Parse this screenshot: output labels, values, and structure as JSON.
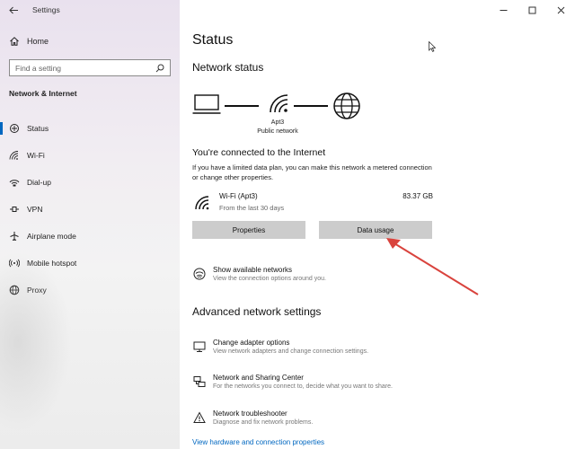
{
  "titlebar": {
    "app_title": "Settings"
  },
  "sidebar": {
    "home": "Home",
    "search_placeholder": "Find a setting",
    "section": "Network & Internet",
    "items": [
      {
        "label": "Status",
        "icon": "status-icon"
      },
      {
        "label": "Wi-Fi",
        "icon": "wifi-icon"
      },
      {
        "label": "Dial-up",
        "icon": "dialup-icon"
      },
      {
        "label": "VPN",
        "icon": "vpn-icon"
      },
      {
        "label": "Airplane mode",
        "icon": "airplane-icon"
      },
      {
        "label": "Mobile hotspot",
        "icon": "hotspot-icon"
      },
      {
        "label": "Proxy",
        "icon": "proxy-icon"
      }
    ]
  },
  "main": {
    "title": "Status",
    "network_status": "Network status",
    "network_name": "Apt3",
    "network_type": "Public network",
    "connected_heading": "You're connected to the Internet",
    "connected_desc": "If you have a limited data plan, you can make this network a metered connection or change other properties.",
    "connection": {
      "name": "Wi-Fi (Apt3)",
      "sub": "From the last 30 days",
      "size": "83.37 GB"
    },
    "buttons": {
      "properties": "Properties",
      "data_usage": "Data usage"
    },
    "show_networks": {
      "title": "Show available networks",
      "desc": "View the connection options around you."
    },
    "advanced_heading": "Advanced network settings",
    "advanced_items": [
      {
        "title": "Change adapter options",
        "desc": "View network adapters and change connection settings."
      },
      {
        "title": "Network and Sharing Center",
        "desc": "For the networks you connect to, decide what you want to share."
      },
      {
        "title": "Network troubleshooter",
        "desc": "Diagnose and fix network problems."
      }
    ],
    "link": "View hardware and connection properties"
  },
  "colors": {
    "accent": "#0067c0",
    "button": "#cccccc",
    "annotation_arrow": "#d9433d"
  }
}
